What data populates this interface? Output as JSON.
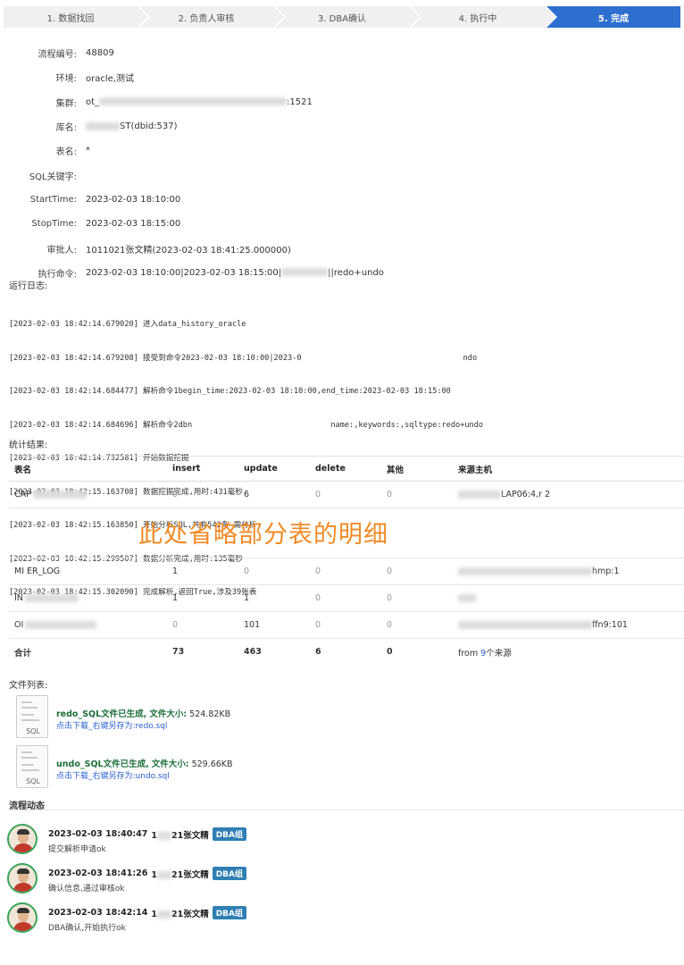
{
  "steps": [
    {
      "label": "1. 数据找回"
    },
    {
      "label": "2. 负责人审核"
    },
    {
      "label": "3. DBA确认"
    },
    {
      "label": "4. 执行中"
    },
    {
      "label": "5. 完成"
    }
  ],
  "info": {
    "flow_id_label": "流程编号:",
    "flow_id": "48809",
    "env_label": "环境:",
    "env": "oracle,测试",
    "cluster_label": "集群:",
    "cluster_prefix": "ot_",
    "cluster_suffix": ":1521",
    "db_label": "库名:",
    "db_suffix": "ST(dbid:537)",
    "table_label": "表名:",
    "table": "*",
    "sql_kw_label": "SQL关键字:",
    "sql_kw": "",
    "start_label": "StartTime:",
    "start": "2023-02-03 18:10:00",
    "stop_label": "StopTime:",
    "stop": "2023-02-03 18:15:00",
    "approver_label": "审批人:",
    "approver": "1011021张文精(2023-02-03 18:41:25.000000)",
    "cmd_label": "执行命令:",
    "cmd_prefix": "2023-02-03 18:10:00|2023-02-03 18:15:00|",
    "cmd_suffix": "||redo+undo"
  },
  "log": {
    "title": "运行日志:",
    "lines": [
      "[2023-02-03 18:42:14.679020] 进入data_history_oracle",
      "[2023-02-03 18:42:14.679208] 接受到命令2023-02-03 18:10:00|2023-0                                   ndo",
      "[2023-02-03 18:42:14.684477] 解析命令1begin_time:2023-02-03 18:10:00,end_time:2023-02-03 18:15:00",
      "[2023-02-03 18:42:14.684696] 解析命令2dbn                              name:,keywords:,sqltype:redo+undo",
      "[2023-02-03 18:42:14.732581] 开始数据挖掘",
      "[2023-02-03 18:42:15.163708] 数据挖掘完成,用时:431毫秒",
      "[2023-02-03 18:42:15.163850] 开始分析SQL,共有542条 需分析",
      "[2023-02-03 18:42:15.299507] 数据分析完成,用时:135毫秒",
      "[2023-02-03 18:42:15.302090] 完成解析,返回True,涉及39张表"
    ]
  },
  "stats": {
    "title": "统计结果:",
    "headers": [
      "表名",
      "insert",
      "update",
      "delete",
      "其他",
      "来源主机"
    ],
    "rows": [
      {
        "name": "CAP",
        "insert": "0",
        "update": "6",
        "delete": "0",
        "other": "0",
        "host": "LAP06:4,r   2"
      },
      {
        "name": "MI         ER_LOG",
        "insert": "1",
        "update": "0",
        "delete": "0",
        "other": "0",
        "host": "hmp:1"
      },
      {
        "name": "IN",
        "insert": "1",
        "update": "1",
        "delete": "0",
        "other": "0",
        "host": ""
      },
      {
        "name": "OI",
        "insert": "0",
        "update": "101",
        "delete": "0",
        "other": "0",
        "host": "ffn9:101"
      }
    ],
    "total": {
      "name": "合计",
      "insert": "73",
      "update": "463",
      "delete": "6",
      "other": "0",
      "host_prefix": "from ",
      "host_count": "9",
      "host_suffix": "个来源"
    },
    "omit_note": "此处省略部分表的明细"
  },
  "files": {
    "title": "文件列表:",
    "items": [
      {
        "gen": "redo_SQL文件已生成,",
        "size_label": "文件大小:",
        "size": "524.82KB",
        "link": "点击下载_右键另存为:redo.sql",
        "ext": "SQL"
      },
      {
        "gen": "undo_SQL文件已生成,",
        "size_label": "文件大小:",
        "size": "529.66KB",
        "link": "点击下载_右键另存为:undo.sql",
        "ext": "SQL"
      }
    ]
  },
  "flow": {
    "title": "流程动态",
    "events": [
      {
        "time": "2023-02-03 18:40:47",
        "user_prefix": "1",
        "user_suffix": "21张文精",
        "badge": "DBA组",
        "desc": "提交解析申请ok"
      },
      {
        "time": "2023-02-03 18:41:26",
        "user_prefix": "1",
        "user_suffix": "21张文精",
        "badge": "DBA组",
        "desc": "确认信息,通过审核ok"
      },
      {
        "time": "2023-02-03 18:42:14",
        "user_prefix": "1",
        "user_suffix": "21张文精",
        "badge": "DBA组",
        "desc": "DBA确认,开始执行ok"
      }
    ]
  }
}
